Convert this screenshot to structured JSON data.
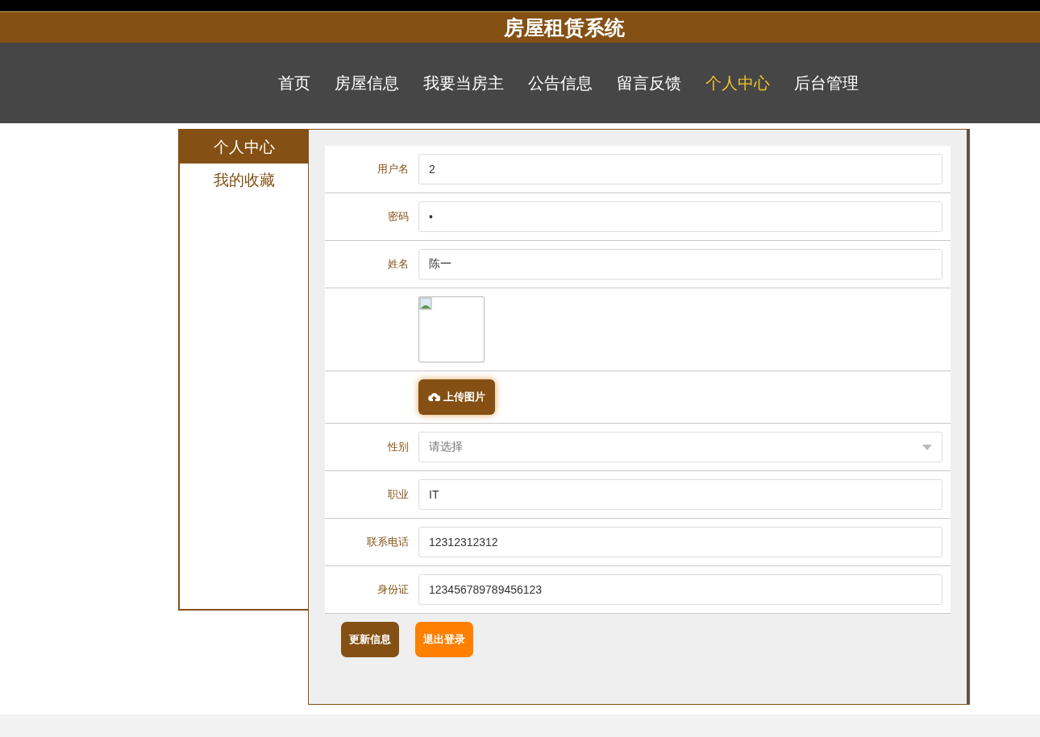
{
  "header": {
    "title": "房屋租赁系统"
  },
  "nav": [
    {
      "label": "首页",
      "selected": false
    },
    {
      "label": "房屋信息",
      "selected": false
    },
    {
      "label": "我要当房主",
      "selected": false
    },
    {
      "label": "公告信息",
      "selected": false
    },
    {
      "label": "留言反馈",
      "selected": false
    },
    {
      "label": "个人中心",
      "selected": true
    },
    {
      "label": "后台管理",
      "selected": false
    }
  ],
  "sidebar": {
    "items": [
      {
        "label": "个人中心",
        "selected": true
      },
      {
        "label": "我的收藏",
        "selected": false
      }
    ]
  },
  "form": {
    "rows": [
      {
        "kind": "text",
        "label": "用户名",
        "value": "2"
      },
      {
        "kind": "text",
        "label": "密码",
        "value": "•"
      },
      {
        "kind": "text",
        "label": "姓名",
        "value": "陈一"
      },
      {
        "kind": "image"
      },
      {
        "kind": "upload",
        "button": "上传图片"
      },
      {
        "kind": "select",
        "label": "性别",
        "placeholder": "请选择"
      },
      {
        "kind": "text",
        "label": "职业",
        "value": "IT"
      },
      {
        "kind": "text",
        "label": "联系电话",
        "value": "12312312312"
      },
      {
        "kind": "text",
        "label": "身份证",
        "value": "123456789789456123"
      }
    ],
    "buttons": [
      {
        "label": "更新信息",
        "kind": "primary"
      },
      {
        "label": "退出登录",
        "kind": "warning"
      }
    ]
  }
}
